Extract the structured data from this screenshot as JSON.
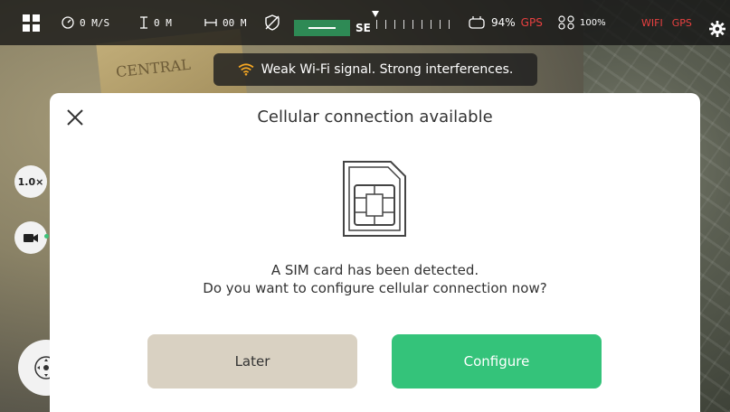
{
  "topbar": {
    "speed": "0 M/S",
    "altitude": "0 M",
    "distance": "00 M",
    "heading": "SE",
    "controller_battery": "94%",
    "gps_label": "GPS",
    "drone_battery": "100%",
    "wifi_label": "WIFI",
    "gps_label_2": "GPS"
  },
  "toast": {
    "text": "Weak Wi-Fi signal. Strong interferences."
  },
  "camera": {
    "background_text": "CENTRAL"
  },
  "controls": {
    "zoom_label": "1.0×"
  },
  "modal": {
    "title": "Cellular connection available",
    "message_line1": "A SIM card has been detected.",
    "message_line2": "Do you want to configure cellular connection now?",
    "later_label": "Later",
    "configure_label": "Configure"
  },
  "colors": {
    "accent_green": "#34c37a",
    "later_bg": "#d9d1c2",
    "warning_red": "#e84040",
    "wifi_orange": "#f5a623"
  },
  "icons": {
    "grid": "grid-icon",
    "speed": "speedometer-icon",
    "altitude": "altitude-icon",
    "distance": "distance-icon",
    "obstacle": "obstacle-off-icon",
    "controller": "controller-icon",
    "drone": "drone-icon",
    "settings": "gear-icon",
    "wifi": "wifi-icon",
    "close": "close-icon",
    "sim": "sim-card-icon",
    "camera": "camera-icon",
    "joystick": "joystick-icon"
  }
}
